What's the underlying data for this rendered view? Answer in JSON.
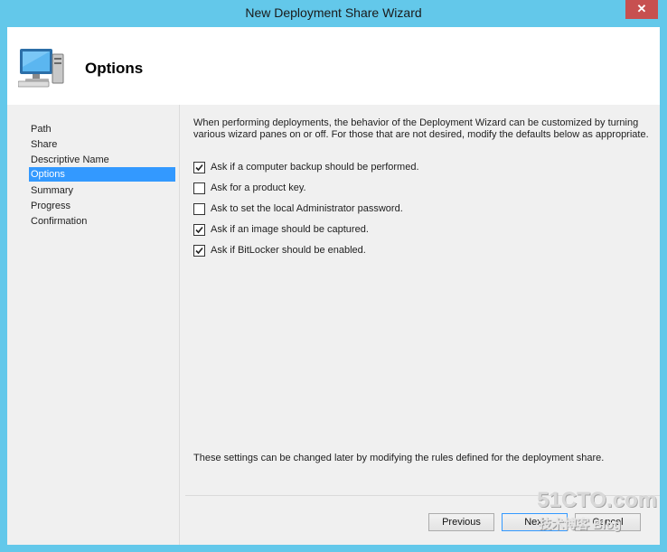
{
  "window": {
    "title": "New Deployment Share Wizard",
    "close_glyph": "✕"
  },
  "header": {
    "title": "Options",
    "icon": "computer-icon"
  },
  "nav": {
    "items": [
      {
        "label": "Path"
      },
      {
        "label": "Share"
      },
      {
        "label": "Descriptive Name"
      },
      {
        "label": "Options",
        "active": true
      },
      {
        "label": "Summary"
      },
      {
        "label": "Progress"
      },
      {
        "label": "Confirmation"
      }
    ]
  },
  "main": {
    "intro": "When performing deployments, the behavior of the Deployment Wizard can be customized by turning various wizard panes on or off.  For those that are not desired, modify the defaults below as appropriate.",
    "options": [
      {
        "label": "Ask if a computer backup should be performed.",
        "checked": true
      },
      {
        "label": "Ask for a product key.",
        "checked": false
      },
      {
        "label": "Ask to set the local Administrator password.",
        "checked": false
      },
      {
        "label": "Ask if an image should be captured.",
        "checked": true
      },
      {
        "label": "Ask if BitLocker should be enabled.",
        "checked": true
      }
    ],
    "footer_note": "These settings can be changed later by modifying the rules defined for the deployment share."
  },
  "buttons": {
    "previous": "Previous",
    "next": "Next",
    "cancel": "Cancel"
  },
  "watermark": {
    "line1": "51CTO.com",
    "line2": "技术博客 Blog"
  },
  "colors": {
    "frame": "#63c8ea",
    "selection": "#3399ff",
    "close": "#c75050"
  }
}
